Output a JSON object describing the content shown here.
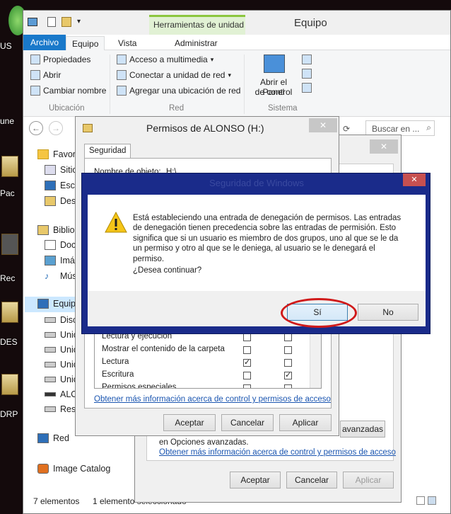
{
  "desktop": {
    "labels": [
      "US",
      "une",
      "Pac",
      "Rec",
      "DES",
      "DRP"
    ]
  },
  "explorer": {
    "title": "Equipo",
    "tool_context": "Herramientas de unidad",
    "tabs": [
      "Archivo",
      "Equipo",
      "Vista",
      "Administrar"
    ],
    "ribbon": {
      "ubicacion": {
        "items": [
          "Propiedades",
          "Abrir",
          "Cambiar nombre"
        ],
        "label": "Ubicación"
      },
      "red": {
        "items": [
          "Acceso a multimedia",
          "Conectar a unidad de red",
          "Agregar una ubicación de red"
        ],
        "label": "Red"
      },
      "sistema": {
        "panel_line1": "Abrir el Panel",
        "panel_line2": "de control",
        "label": "Sistema"
      }
    },
    "search_placeholder": "Buscar en ...",
    "nav": [
      "Favori",
      "Sitio",
      "Escr",
      "Desc",
      "Biblio",
      "Doc",
      "Imá",
      "Mús",
      "Equip",
      "Disc",
      "Unic",
      "Unic",
      "Unic",
      "Unic",
      "ALO",
      "Rese",
      "Red",
      "Image Catalog"
    ],
    "status": {
      "count": "7 elementos",
      "selected": "1 elemento seleccionado"
    }
  },
  "props_dialog": {
    "buttons": [
      "Aceptar",
      "Cancelar",
      "Aplicar"
    ],
    "advanced_button": "avanzadas",
    "note": "en Opciones avanzadas.",
    "link": "Obtener más información acerca de control y permisos de acceso"
  },
  "perm_dialog": {
    "title": "Permisos de ALONSO (H:)",
    "tab": "Seguridad",
    "object_label": "Nombre de objeto:",
    "object_value": "H:\\",
    "rows": [
      {
        "name": "Lectura y ejecución",
        "allow": false,
        "deny": false
      },
      {
        "name": "Mostrar el contenido de la carpeta",
        "allow": false,
        "deny": false
      },
      {
        "name": "Lectura",
        "allow": true,
        "deny": false
      },
      {
        "name": "Escritura",
        "allow": false,
        "deny": true
      },
      {
        "name": "Permisos especiales",
        "allow": false,
        "deny": false
      }
    ],
    "link": "Obtener más información acerca de control y permisos de acceso",
    "buttons": [
      "Aceptar",
      "Cancelar",
      "Aplicar"
    ]
  },
  "security_dialog": {
    "title": "Seguridad de Windows",
    "message": "Está estableciendo una entrada de denegación de permisos. Las entradas de denegación tienen precedencia sobre las entradas de permisión. Esto significa que si un usuario es miembro de dos grupos, uno al que se le da un permiso y otro al que se le deniega, al usuario se le denegará el permiso.",
    "question": "¿Desea continuar?",
    "yes": "Sí",
    "no": "No"
  }
}
